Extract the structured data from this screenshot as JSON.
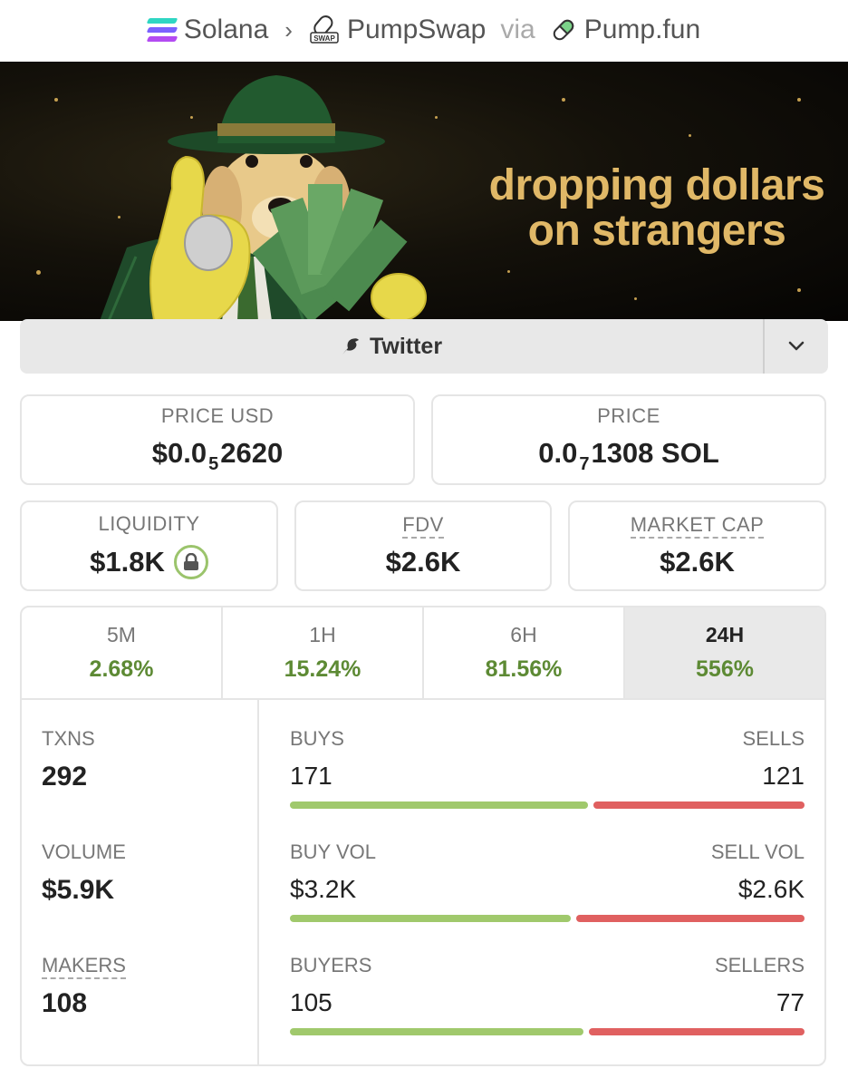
{
  "breadcrumb": {
    "chain": "Solana",
    "dex": "PumpSwap",
    "dex_icon_text": "SWAP",
    "via": "via",
    "launchpad": "Pump.fun"
  },
  "banner": {
    "text_line1": "dropping dollars",
    "text_line2": "on strangers"
  },
  "socials": {
    "twitter_label": "Twitter"
  },
  "price_usd": {
    "label": "PRICE USD",
    "prefix": "$0.0",
    "zeros": "5",
    "digits": "2620"
  },
  "price_native": {
    "label": "PRICE",
    "prefix": "0.0",
    "zeros": "7",
    "digits": "1308",
    "unit": "SOL"
  },
  "liquidity": {
    "label": "LIQUIDITY",
    "value": "$1.8K"
  },
  "fdv": {
    "label": "FDV",
    "value": "$2.6K"
  },
  "market_cap": {
    "label": "MARKET CAP",
    "value": "$2.6K"
  },
  "tabs": [
    {
      "label": "5M",
      "value": "2.68%"
    },
    {
      "label": "1H",
      "value": "15.24%"
    },
    {
      "label": "6H",
      "value": "81.56%"
    },
    {
      "label": "24H",
      "value": "556%",
      "active": true
    }
  ],
  "stats": {
    "txns": {
      "label": "TXNS",
      "value": "292"
    },
    "volume": {
      "label": "VOLUME",
      "value": "$5.9K"
    },
    "makers": {
      "label": "MAKERS",
      "value": "108"
    }
  },
  "ratios": {
    "trades": {
      "left_label": "BUYS",
      "right_label": "SELLS",
      "left_value": "171",
      "right_value": "121",
      "left_share": 0.586
    },
    "volume": {
      "left_label": "BUY VOL",
      "right_label": "SELL VOL",
      "left_value": "$3.2K",
      "right_value": "$2.6K",
      "left_share": 0.552
    },
    "traders": {
      "left_label": "BUYERS",
      "right_label": "SELLERS",
      "left_value": "105",
      "right_value": "77",
      "left_share": 0.577
    }
  },
  "colors": {
    "positive": "#5d8a34",
    "buy_bar": "#a0c96c",
    "sell_bar": "#e06060",
    "banner_text": "#e0b867"
  }
}
